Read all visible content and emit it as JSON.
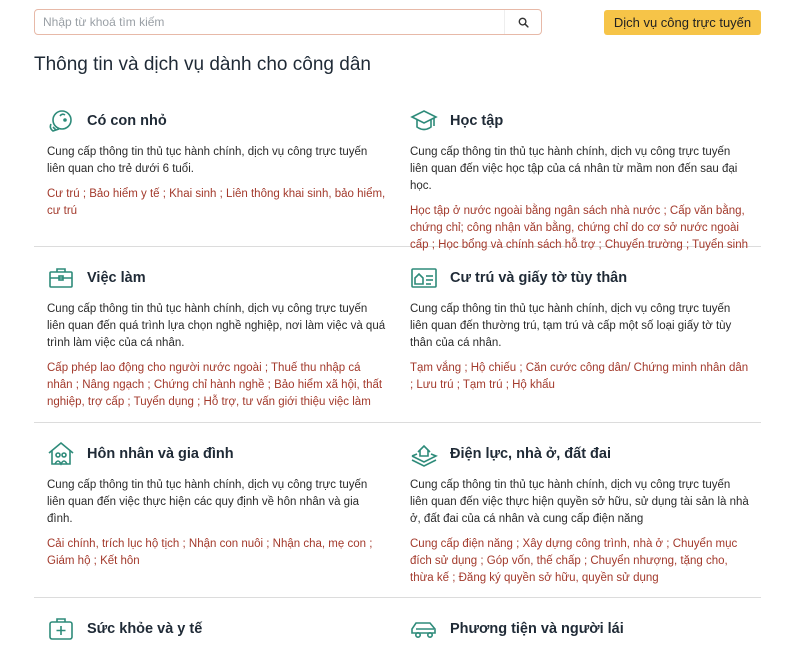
{
  "search": {
    "placeholder": "Nhập từ khoá tìm kiếm"
  },
  "header": {
    "cta_label": "Dịch vụ công trực tuyến"
  },
  "page": {
    "title": "Thông tin và dịch vụ dành cho công dân"
  },
  "accent_color": "#2e8b7a",
  "link_color": "#a33a2c",
  "categories": [
    {
      "icon": "baby-icon",
      "title": "Có con nhỏ",
      "description": "Cung cấp thông tin thủ tục hành chính, dịch vụ công trực tuyến liên quan cho trẻ dưới 6 tuổi.",
      "links": [
        "Cư trú",
        "Bảo hiểm y tế",
        "Khai sinh",
        "Liên thông khai sinh, bảo hiểm, cư trú"
      ]
    },
    {
      "icon": "graduation-cap-icon",
      "title": "Học tập",
      "description": "Cung cấp thông tin thủ tục hành chính, dịch vụ công trực tuyến liên quan đến việc học tập của cá nhân từ mầm non đến sau đại học.",
      "links": [
        "Học tập ở nước ngoài bằng ngân sách nhà nước",
        "Cấp văn bằng, chứng chỉ; công nhận văn bằng, chứng chỉ do cơ sở nước ngoài cấp",
        "Học bổng và chính sách hỗ trợ",
        "Chuyển trường",
        "Tuyển sinh"
      ]
    },
    {
      "icon": "briefcase-icon",
      "title": "Việc làm",
      "description": "Cung cấp thông tin thủ tục hành chính, dịch vụ công trực tuyến liên quan đến quá trình lựa chọn nghề nghiệp, nơi làm việc và quá trình làm việc của cá nhân.",
      "links": [
        "Cấp phép lao động cho người nước ngoài",
        "Thuế thu nhập cá nhân",
        "Nâng ngạch",
        "Chứng chỉ hành nghề",
        "Bảo hiểm xã hội, thất nghiệp, trợ cấp",
        "Tuyển dụng",
        "Hỗ trợ, tư vấn giới thiệu việc làm"
      ]
    },
    {
      "icon": "id-card-icon",
      "title": "Cư trú và giấy tờ tùy thân",
      "description": "Cung cấp thông tin thủ tục hành chính, dịch vụ công trực tuyến liên quan đến thường trú, tạm trú và cấp một số loại giấy tờ tùy thân của cá nhân.",
      "links": [
        "Tạm vắng",
        "Hộ chiếu",
        "Căn cước công dân/ Chứng minh nhân dân",
        "Lưu trú",
        "Tạm trú",
        "Hộ khẩu"
      ]
    },
    {
      "icon": "family-house-icon",
      "title": "Hôn nhân và gia đình",
      "description": "Cung cấp thông tin thủ tục hành chính, dịch vụ công trực tuyến liên quan đến việc thực hiện các quy định về hôn nhân và gia đình.",
      "links": [
        "Cải chính, trích lục hộ tịch",
        "Nhận con nuôi",
        "Nhận cha, mẹ con",
        "Giám hộ",
        "Kết hôn"
      ]
    },
    {
      "icon": "land-house-icon",
      "title": "Điện lực, nhà ở, đất đai",
      "description": "Cung cấp thông tin thủ tục hành chính, dịch vụ công trực tuyến liên quan đến việc thực hiện quyền sở hữu, sử dụng tài sản là nhà ở, đất đai của cá nhân và cung cấp điện năng",
      "links": [
        "Cung cấp điện năng",
        "Xây dựng công trình, nhà ở",
        "Chuyển mục đích sử dụng",
        "Góp vốn, thế chấp",
        "Chuyển nhượng, tặng cho, thừa kế",
        "Đăng ký quyền sở hữu, quyền sử dụng"
      ]
    },
    {
      "icon": "medical-kit-icon",
      "title": "Sức khỏe và y tế",
      "description": "",
      "links": []
    },
    {
      "icon": "car-icon",
      "title": "Phương tiện và người lái",
      "description": "",
      "links": []
    }
  ]
}
